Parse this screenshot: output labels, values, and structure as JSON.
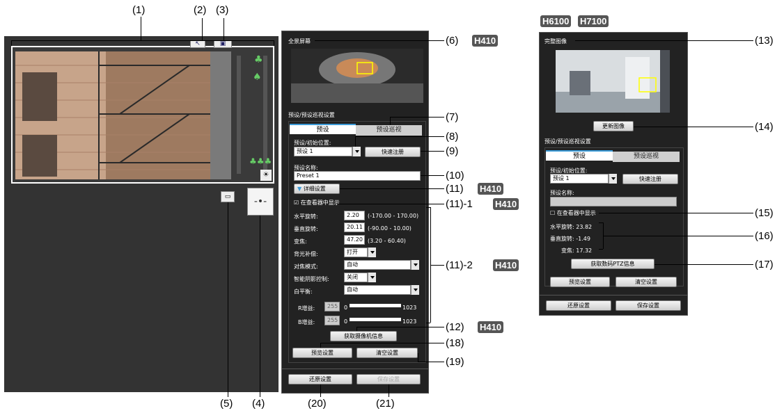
{
  "callouts": {
    "c1": "(1)",
    "c2": "(2)",
    "c3": "(3)",
    "c4": "(4)",
    "c5": "(5)",
    "c6": "(6)",
    "c7": "(7)",
    "c8": "(8)",
    "c9": "(9)",
    "c10": "(10)",
    "c11": "(11)",
    "c11_1": "(11)-1",
    "c11_2": "(11)-2",
    "c12": "(12)",
    "c13": "(13)",
    "c14": "(14)",
    "c15": "(15)",
    "c16": "(16)",
    "c17": "(17)",
    "c18": "(18)",
    "c19": "(19)",
    "c20": "(20)",
    "c21": "(21)"
  },
  "badges": {
    "h410": "H410",
    "h6100": "H6100",
    "h7100": "H7100"
  },
  "left_panel": {
    "panorama_title": "全景屏幕",
    "preset_section_title": "预设/预设巡视设置",
    "tab_preset": "预设",
    "tab_tour": "预设巡视",
    "preset_initial_label": "预设/初始位置:",
    "preset_select_value": "预设 1",
    "quick_register_label": "快速注册",
    "preset_name_label": "预设名称:",
    "preset_name_value": "Preset 1",
    "detail_settings_label": "详细设置",
    "show_in_viewer_label": "在查看器中显示",
    "pan_label": "水平旋转:",
    "pan_value": "2.20",
    "pan_range": "(-170.00 - 170.00)",
    "tilt_label": "垂直旋转:",
    "tilt_value": "20.11",
    "tilt_range": "(-90.00 - 10.00)",
    "zoom_label": "变焦:",
    "zoom_value": "47.20",
    "zoom_range": "(3.20 - 60.40)",
    "backlight_label": "背光补偿:",
    "backlight_value": "打开",
    "focus_mode_label": "对焦模式:",
    "focus_mode_value": "自动",
    "shade_label": "智能阴影控制:",
    "shade_value": "关闭",
    "wb_label": "白平衡:",
    "wb_value": "自动",
    "rgain_label": "R增益:",
    "rgain_value": "255",
    "rgain_min": "0",
    "rgain_max": "1023",
    "bgain_label": "B增益:",
    "bgain_value": "255",
    "bgain_min": "0",
    "bgain_max": "1023",
    "get_camera_info_label": "获取摄像机信息",
    "preview_settings_label": "预览设置",
    "clear_settings_label": "清空设置",
    "restore_label": "还原设置",
    "save_label": "保存设置"
  },
  "right_panel": {
    "full_image_title": "完整图像",
    "update_image_label": "更新图像",
    "preset_section_title": "预设/预设巡视设置",
    "tab_preset": "预设",
    "tab_tour": "预设巡视",
    "preset_initial_label": "预设/初始位置:",
    "preset_select_value": "预设 1",
    "quick_register_label": "快速注册",
    "preset_name_label": "预设名称:",
    "show_in_viewer_label": "在查看器中显示",
    "pan_text": "水平旋转: 23.82",
    "tilt_text": "垂直旋转: -1.49",
    "zoom_text": "变焦: 17.32",
    "get_ptz_label": "获取数码PTZ信息",
    "preview_settings_label": "预览设置",
    "clear_settings_label": "清空设置",
    "restore_label": "还原设置",
    "save_label": "保存设置"
  }
}
